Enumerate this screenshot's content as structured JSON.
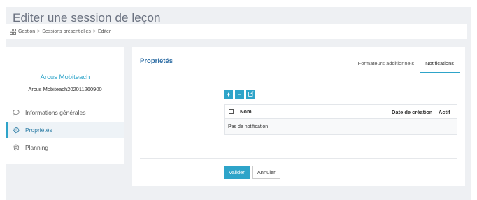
{
  "page_title": "Editer une session de leçon",
  "breadcrumb": {
    "icon": "grid-icon",
    "items": [
      "Gestion",
      "Sessions présentielles",
      "Editer"
    ],
    "separator": ">"
  },
  "left_panel": {
    "company_name": "Arcus Mobiteach",
    "company_id": "Arcus Mobiteach202011260900",
    "nav": [
      {
        "label": "Informations générales",
        "icon": "speech-bubble-icon",
        "active": false
      },
      {
        "label": "Propriétés",
        "icon": "gear-icon",
        "active": true
      },
      {
        "label": "Planning",
        "icon": "gear-icon",
        "active": false
      }
    ]
  },
  "main": {
    "title": "Propriétés",
    "tabs": [
      {
        "label": "Formateurs additionnels",
        "active": false
      },
      {
        "label": "Notifications",
        "active": true
      }
    ],
    "toolbar": {
      "add_label": "+",
      "remove_label": "−",
      "edit_icon": "edit-icon"
    },
    "table": {
      "headers": {
        "name": "Nom",
        "date": "Date de création",
        "active": "Actif"
      },
      "empty_text": "Pas de notification"
    },
    "buttons": {
      "submit": "Valider",
      "cancel": "Annuler"
    }
  },
  "colors": {
    "accent": "#2ea4c9",
    "title_blue": "#2e6da4",
    "background": "#eef0f3"
  }
}
